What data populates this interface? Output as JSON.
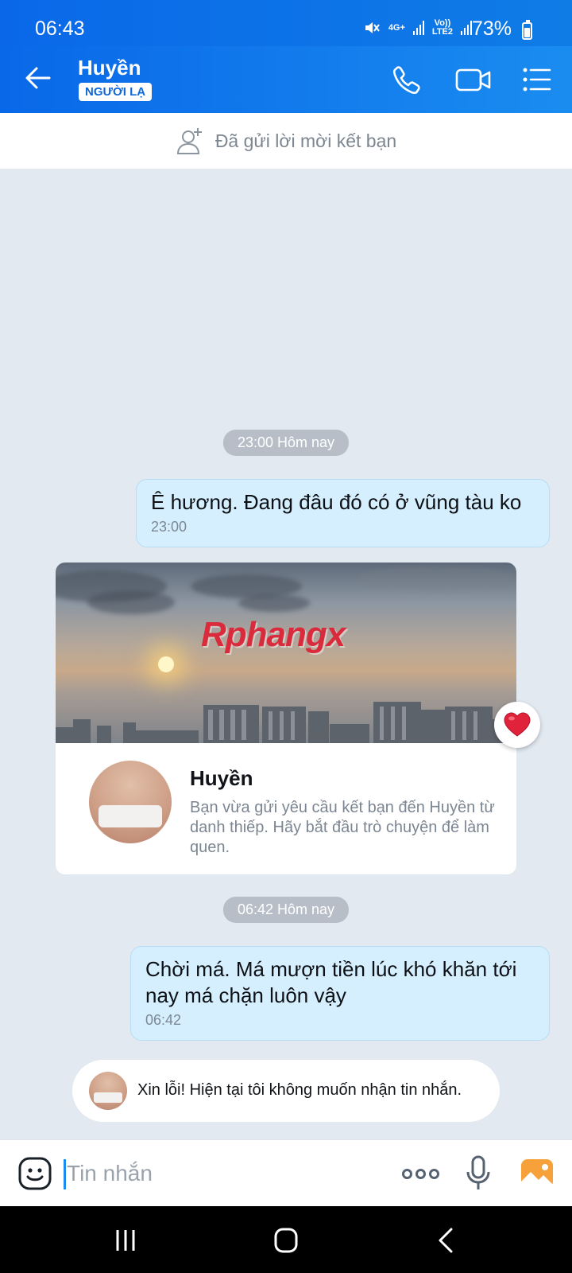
{
  "status_bar": {
    "time": "06:43",
    "network_4g": "4G+",
    "volte": "Vo))",
    "lte": "LTE2",
    "battery": "73%"
  },
  "header": {
    "contact_name": "Huyền",
    "badge": "NGƯỜI LẠ"
  },
  "banner": {
    "text": "Đã gửi lời mời kết bạn"
  },
  "messages": {
    "time_pill_1": "23:00 Hôm nay",
    "out_1": {
      "text": "Ê hương. Đang đâu đó có ở vũng tàu ko",
      "time": "23:00"
    },
    "card": {
      "watermark": "Rphangx",
      "name": "Huyền",
      "description": "Bạn vừa gửi yêu cầu kết bạn đến Huyền từ danh thiếp. Hãy bắt đầu trò chuyện để làm quen."
    },
    "time_pill_2": "06:42 Hôm nay",
    "out_2": {
      "text": "Chời má. Má mượn tiền lúc khó khăn tới nay má chặn luôn vậy",
      "time": "06:42"
    },
    "auto_reply": "Xin lỗi! Hiện tại tôi không muốn nhận tin nhắn."
  },
  "input": {
    "placeholder": "Tin nhắn",
    "value": ""
  },
  "colors": {
    "header_blue": "#0968e8",
    "outgoing_bubble": "#d5efff",
    "chat_background": "#e2e9f1"
  },
  "icons": [
    "back-arrow-icon",
    "phone-icon",
    "video-call-icon",
    "menu-list-icon",
    "add-friend-icon",
    "heart-icon",
    "emoji-icon",
    "more-icon",
    "mic-icon",
    "image-icon",
    "nav-recents-icon",
    "nav-home-icon",
    "nav-back-icon"
  ]
}
